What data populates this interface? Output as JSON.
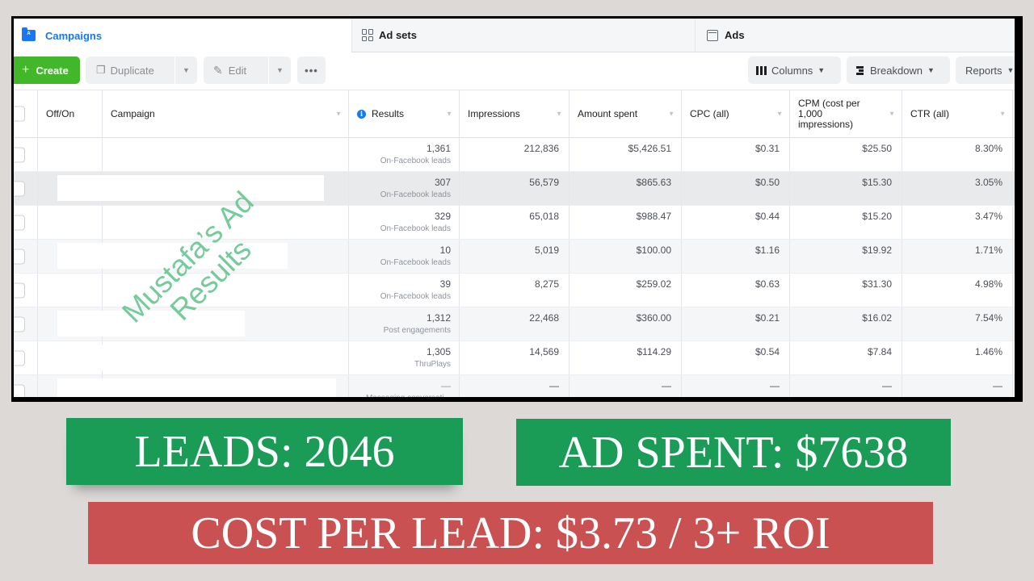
{
  "level_tabs": {
    "campaigns": "Campaigns",
    "campaigns_icon_letter": "A",
    "ad_sets": "Ad sets",
    "ads": "Ads"
  },
  "toolbar": {
    "create": "Create",
    "duplicate": "Duplicate",
    "edit": "Edit",
    "more": "•••",
    "columns": "Columns",
    "breakdown": "Breakdown",
    "reports": "Reports"
  },
  "table": {
    "headers": {
      "off_on": "Off/On",
      "campaign": "Campaign",
      "results": "Results",
      "impressions": "Impressions",
      "amount_spent": "Amount spent",
      "cpc": "CPC (all)",
      "cpm": "CPM (cost per 1,000 impressions)",
      "ctr": "CTR (all)"
    },
    "rows": [
      {
        "results": "1,361",
        "result_type": "On-Facebook leads",
        "impressions": "212,836",
        "amount_spent": "$5,426.51",
        "cpc": "$0.31",
        "cpm": "$25.50",
        "ctr": "8.30%"
      },
      {
        "results": "307",
        "result_type": "On-Facebook leads",
        "impressions": "56,579",
        "amount_spent": "$865.63",
        "cpc": "$0.50",
        "cpm": "$15.30",
        "ctr": "3.05%"
      },
      {
        "results": "329",
        "result_type": "On-Facebook leads",
        "impressions": "65,018",
        "amount_spent": "$988.47",
        "cpc": "$0.44",
        "cpm": "$15.20",
        "ctr": "3.47%"
      },
      {
        "results": "10",
        "result_type": "On-Facebook leads",
        "impressions": "5,019",
        "amount_spent": "$100.00",
        "cpc": "$1.16",
        "cpm": "$19.92",
        "ctr": "1.71%"
      },
      {
        "results": "39",
        "result_type": "On-Facebook leads",
        "impressions": "8,275",
        "amount_spent": "$259.02",
        "cpc": "$0.63",
        "cpm": "$31.30",
        "ctr": "4.98%"
      },
      {
        "results": "1,312",
        "result_type": "Post engagements",
        "impressions": "22,468",
        "amount_spent": "$360.00",
        "cpc": "$0.21",
        "cpm": "$16.02",
        "ctr": "7.54%"
      },
      {
        "results": "1,305",
        "result_type": "ThruPlays",
        "impressions": "14,569",
        "amount_spent": "$114.29",
        "cpc": "$0.54",
        "cpm": "$7.84",
        "ctr": "1.46%"
      },
      {
        "results": "—",
        "result_type": "Messaging conversati...",
        "impressions": "—",
        "amount_spent": "—",
        "cpc": "—",
        "cpm": "—",
        "ctr": "—"
      }
    ]
  },
  "watermark": {
    "line1": "Mustafa’s Ad",
    "line2": "Results"
  },
  "banners": {
    "leads": "LEADS: 2046",
    "ad_spent": "AD SPENT: $7638",
    "cost_per_lead": "COST PER LEAD: $3.73 / 3+ ROI"
  },
  "colors": {
    "brand_blue": "#1877f2",
    "create_green": "#42b72a",
    "banner_green": "#1a9c57",
    "banner_red": "#c95151",
    "watermark_green": "#5fc38a"
  }
}
